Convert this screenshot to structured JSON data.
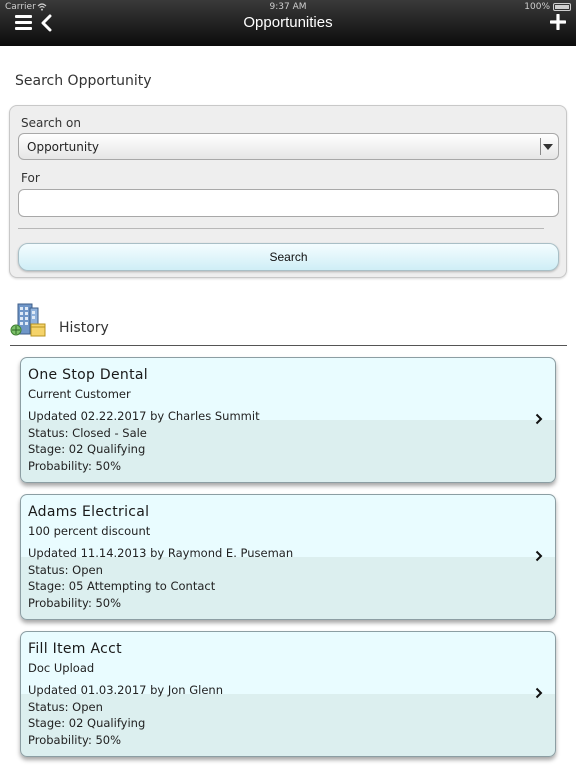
{
  "status_bar": {
    "carrier": "Carrier",
    "time": "9:37 AM",
    "battery": "100%"
  },
  "nav": {
    "title": "Opportunities",
    "left_icons": [
      "menu-icon",
      "back-icon"
    ],
    "right_icon": "add-icon"
  },
  "search": {
    "title": "Search Opportunity",
    "search_on_label": "Search on",
    "search_on_value": "Opportunity",
    "for_label": "For",
    "for_value": "",
    "button_label": "Search"
  },
  "history": {
    "title": "History",
    "icon": "building-history-icon",
    "items": [
      {
        "name": "One Stop Dental",
        "subtitle": "Current Customer",
        "updated": "Updated 02.22.2017 by Charles Summit",
        "status": "Status: Closed - Sale",
        "stage": "Stage: 02 Qualifying",
        "probability": "Probability: 50%"
      },
      {
        "name": "Adams Electrical",
        "subtitle": "100 percent discount",
        "updated": "Updated 11.14.2013 by Raymond E. Puseman",
        "status": "Status: Open",
        "stage": "Stage: 05 Attempting to Contact",
        "probability": "Probability: 50%"
      },
      {
        "name": "Fill Item Acct",
        "subtitle": "Doc Upload",
        "updated": "Updated 01.03.2017 by Jon Glenn",
        "status": "Status: Open",
        "stage": "Stage: 02 Qualifying",
        "probability": "Probability: 50%"
      }
    ]
  },
  "colors": {
    "nav_bg": "#1a1a1a",
    "card_top": "#e9fcff",
    "card_bottom": "#dcefef",
    "button": "#cfeef6"
  }
}
